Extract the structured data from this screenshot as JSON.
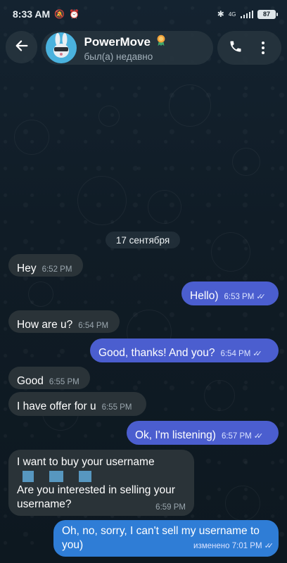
{
  "status_bar": {
    "time": "8:33 AM",
    "network": "4G",
    "battery": "87"
  },
  "header": {
    "back_label": "←",
    "title": "PowerMove",
    "status": "был(а) недавно"
  },
  "date_chip": "17 сентября",
  "messages": [
    {
      "text": "Hey",
      "time": "6:52 PM"
    },
    {
      "text": "Hello)",
      "time": "6:53 PM"
    },
    {
      "text": "How are u?",
      "time": "6:54 PM"
    },
    {
      "text": "Good, thanks! And you?",
      "time": "6:54 PM"
    },
    {
      "text": "Good",
      "time": "6:55 PM"
    },
    {
      "text": "I have offer for u",
      "time": "6:55 PM"
    },
    {
      "text": "Ok, I'm listening)",
      "time": "6:57 PM"
    },
    {
      "text_line1": "I want to buy your username",
      "text_line2": "Are you interested in selling your username?",
      "time": "6:59 PM"
    },
    {
      "text": "Oh, no, sorry, I can't sell my username to you)",
      "time": "изменено 7:01 PM"
    }
  ],
  "colors": {
    "incoming_bubble": "#2a3338",
    "outgoing_bubble": "#4b5ecf",
    "outgoing_last": "#2f7dd6"
  }
}
